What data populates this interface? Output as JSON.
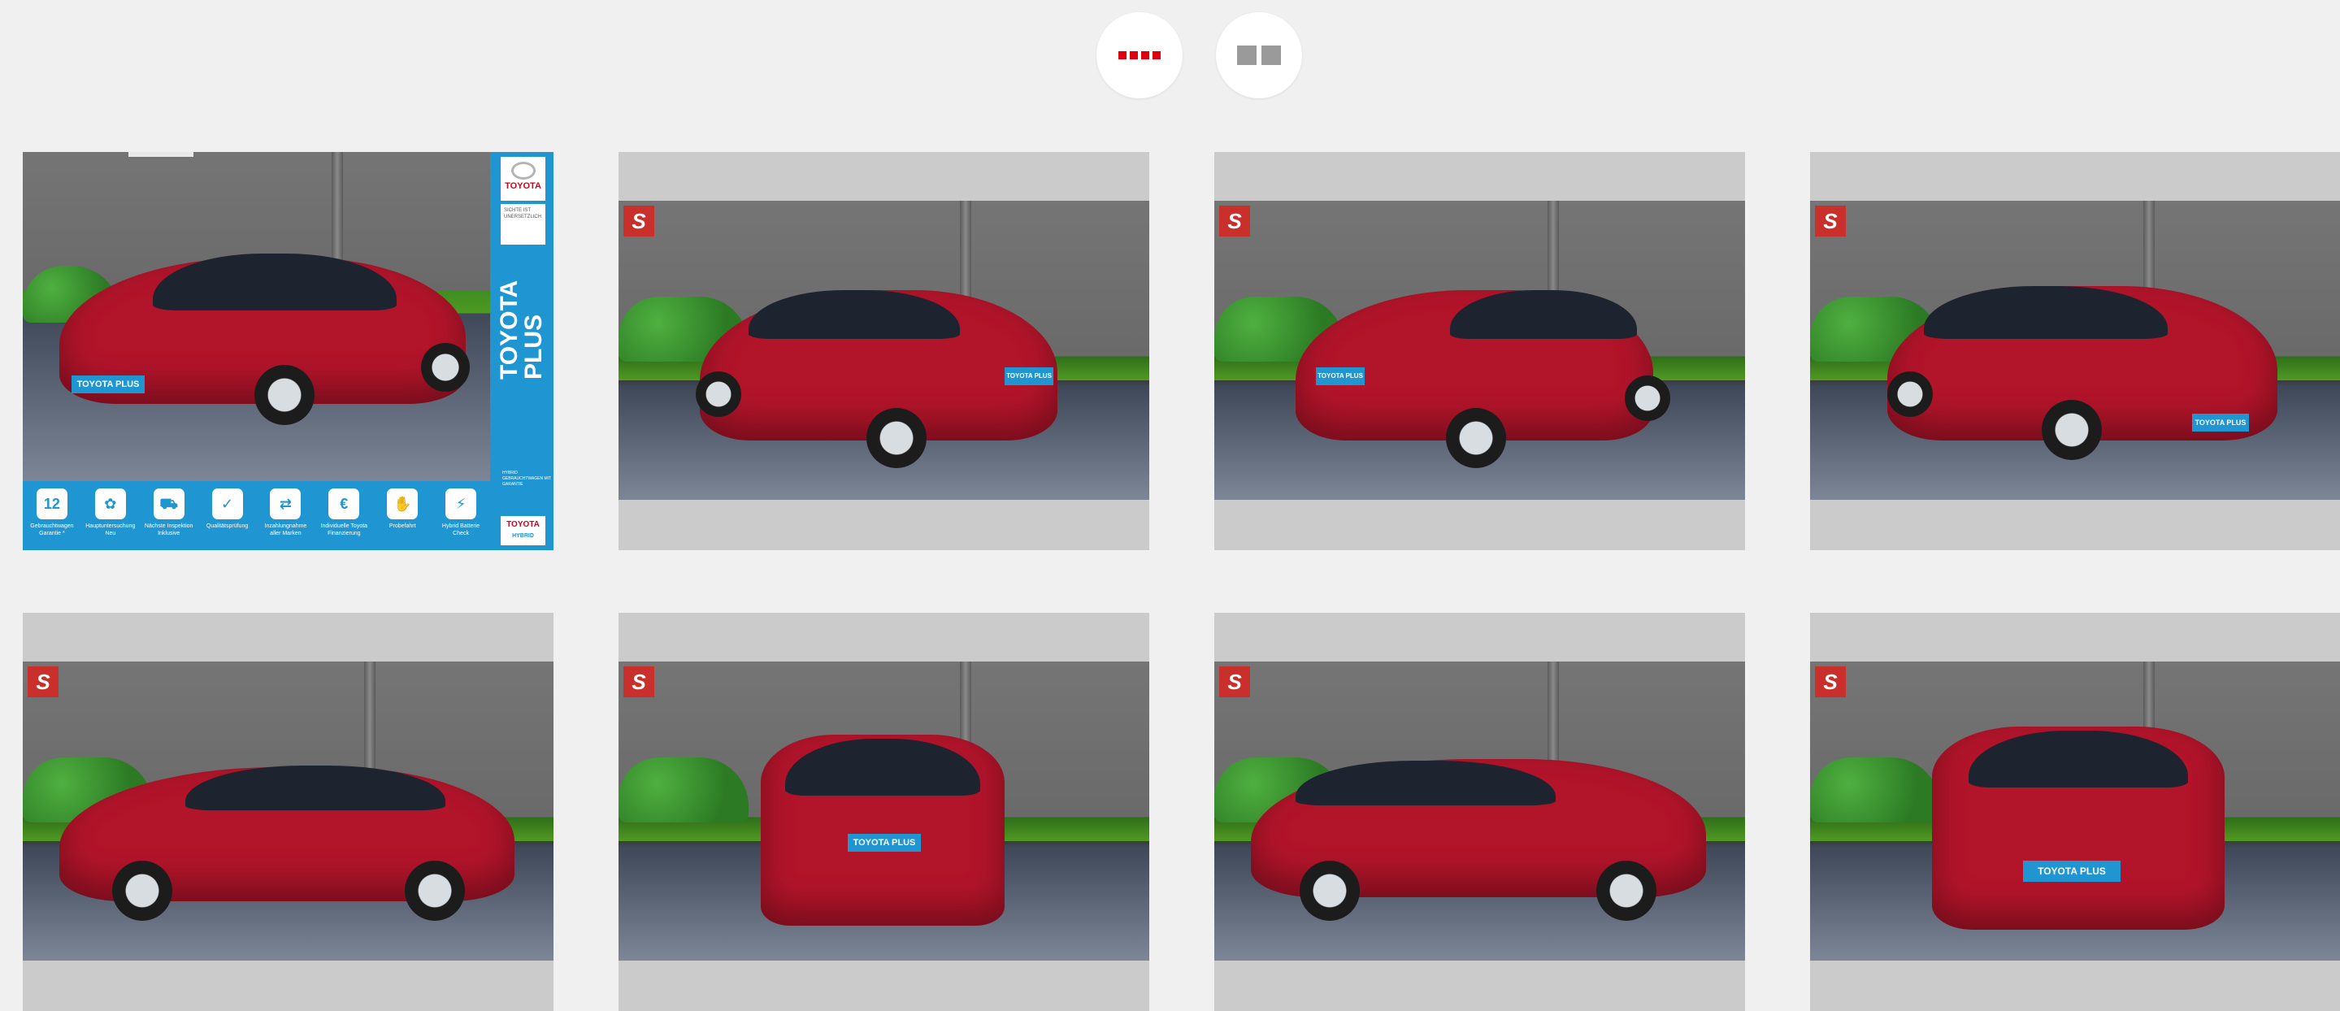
{
  "toolbar": {
    "list_view_icon": "red-dots-list-icon",
    "grid_view_icon": "grey-tiles-grid-icon",
    "active_color": "#e0000f",
    "inactive_color": "#9a9a9a"
  },
  "gallery": {
    "photo_count": 8,
    "placeholder_color": "#cbcbcb",
    "car_color": "#b2142a",
    "brochure": {
      "brand": "TOYOTA",
      "tagline": "SICHTE IST UNERSETZLICH",
      "big_title": "TOYOTA PLUS",
      "subtitle": "HYBRID GEBRAUCHTWAGEN MIT GARANTIE",
      "hybrid_brand": "TOYOTA",
      "hybrid_label": "HYBRID",
      "plate_text": "TOYOTA PLUS",
      "features": [
        {
          "icon": "12",
          "label": "Gebrauchtwagen Garantie *"
        },
        {
          "icon": "✿",
          "label": "Hauptuntersuchung Neu"
        },
        {
          "icon": "⛟",
          "label": "Nächste Inspektion Inklusive"
        },
        {
          "icon": "✓",
          "label": "Qualitätsprüfung"
        },
        {
          "icon": "⇄",
          "label": "Inzahlungnahme aller Marken"
        },
        {
          "icon": "€",
          "label": "Individuelle Toyota Finanzierung"
        },
        {
          "icon": "✋",
          "label": "Probefahrt"
        },
        {
          "icon": "⚡",
          "label": "Hybrid Batterie Check"
        }
      ]
    },
    "dealer_badge": "S",
    "plate_text": "TOYOTA PLUS"
  }
}
